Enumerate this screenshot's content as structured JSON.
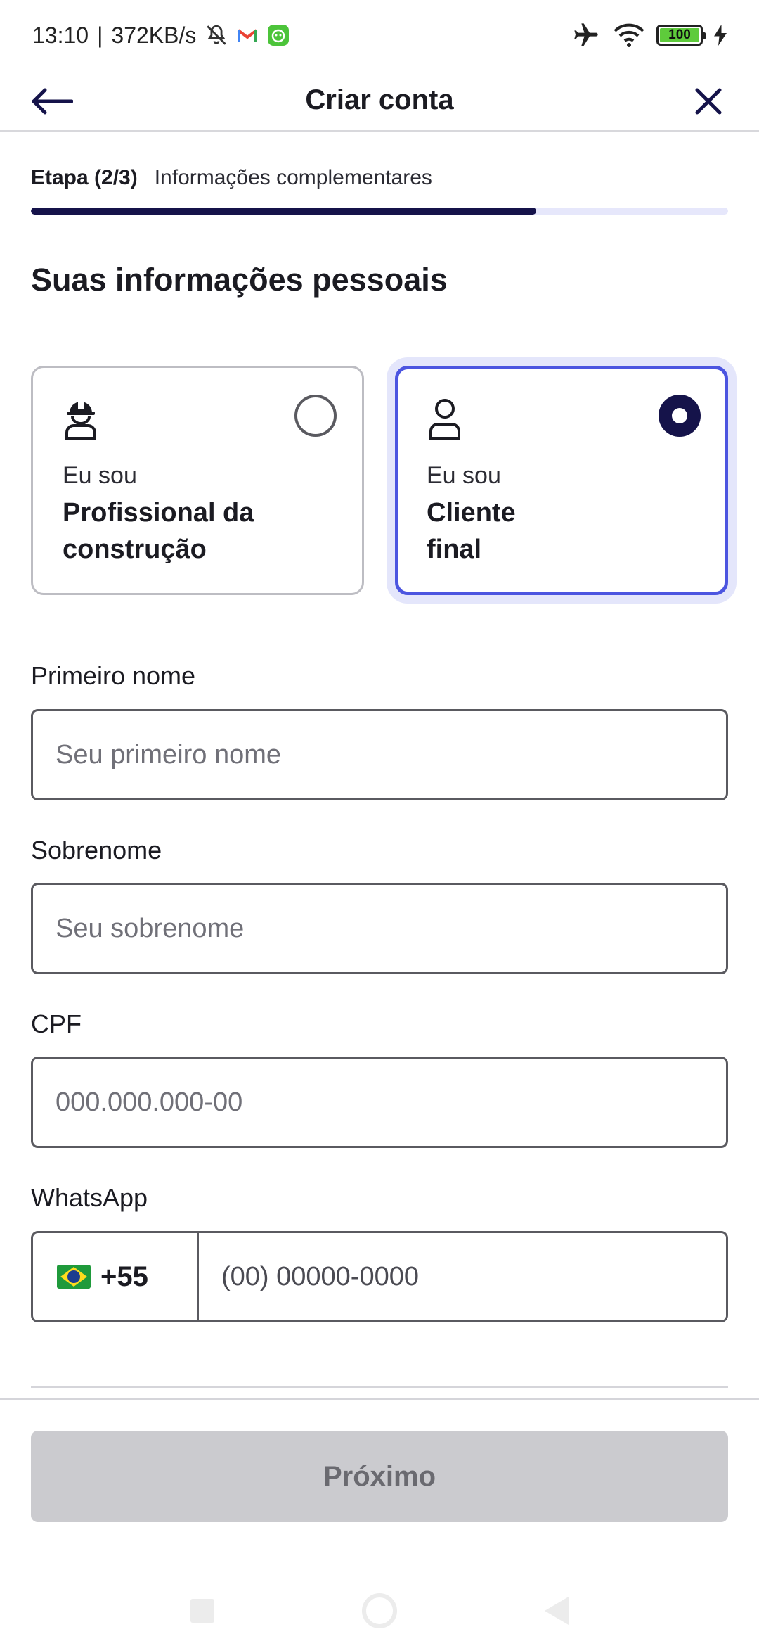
{
  "status_bar": {
    "time": "13:10",
    "separator": "|",
    "speed": "372KB/s",
    "battery": "100"
  },
  "header": {
    "title": "Criar conta"
  },
  "step": {
    "label": "Etapa (2/3)",
    "description": "Informações complementares",
    "progress_fraction": 0.725
  },
  "section": {
    "title": "Suas informações pessoais"
  },
  "account_types": [
    {
      "prefix": "Eu sou",
      "title": "Profissional da construção",
      "selected": false
    },
    {
      "prefix": "Eu sou",
      "title": "Cliente final",
      "selected": true
    }
  ],
  "form": {
    "first_name": {
      "label": "Primeiro nome",
      "placeholder": "Seu primeiro nome",
      "value": ""
    },
    "last_name": {
      "label": "Sobrenome",
      "placeholder": "Seu sobrenome",
      "value": ""
    },
    "cpf": {
      "label": "CPF",
      "placeholder": "000.000.000-00",
      "value": ""
    },
    "whatsapp": {
      "label": "WhatsApp",
      "country_code": "+55",
      "placeholder": "(00) 00000-0000",
      "value": ""
    }
  },
  "actions": {
    "next_label": "Próximo"
  },
  "colors": {
    "primary": "#15134a",
    "selected_border": "#4c55e0",
    "progress_track": "#e6e7fb",
    "disabled_button": "#cbcbcf"
  }
}
